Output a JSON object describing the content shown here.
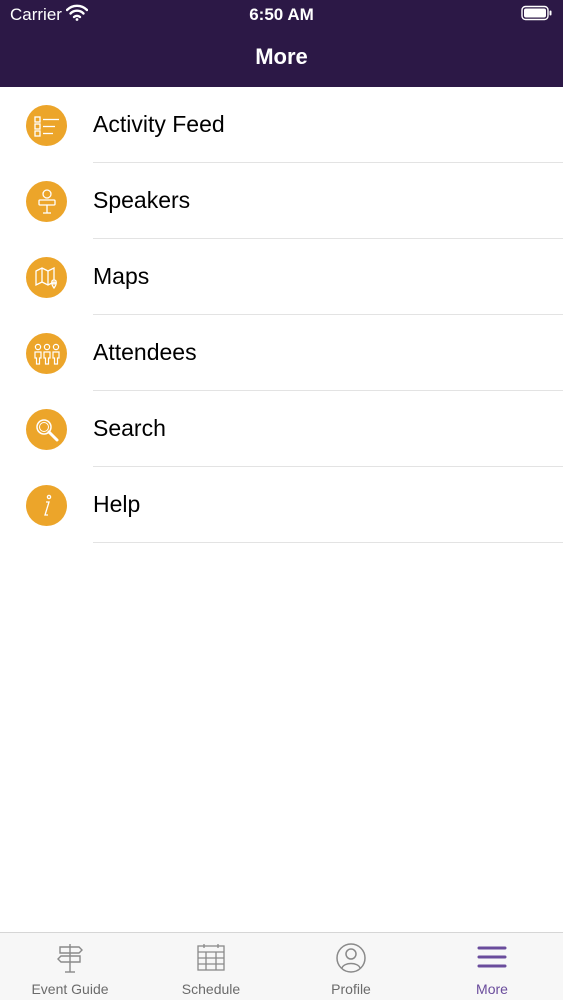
{
  "status_bar": {
    "carrier": "Carrier",
    "time": "6:50 AM"
  },
  "header": {
    "title": "More"
  },
  "menu": {
    "items": [
      {
        "label": "Activity Feed",
        "icon": "list-icon"
      },
      {
        "label": "Speakers",
        "icon": "speaker-icon"
      },
      {
        "label": "Maps",
        "icon": "map-icon"
      },
      {
        "label": "Attendees",
        "icon": "people-icon"
      },
      {
        "label": "Search",
        "icon": "search-icon"
      },
      {
        "label": "Help",
        "icon": "info-icon"
      }
    ]
  },
  "tab_bar": {
    "tabs": [
      {
        "label": "Event Guide",
        "icon": "signpost-icon"
      },
      {
        "label": "Schedule",
        "icon": "calendar-icon"
      },
      {
        "label": "Profile",
        "icon": "profile-icon"
      },
      {
        "label": "More",
        "icon": "menu-icon",
        "active": true
      }
    ]
  },
  "colors": {
    "header_bg": "#2c1846",
    "accent": "#eca52a",
    "active_tab": "#6a4c9c"
  }
}
